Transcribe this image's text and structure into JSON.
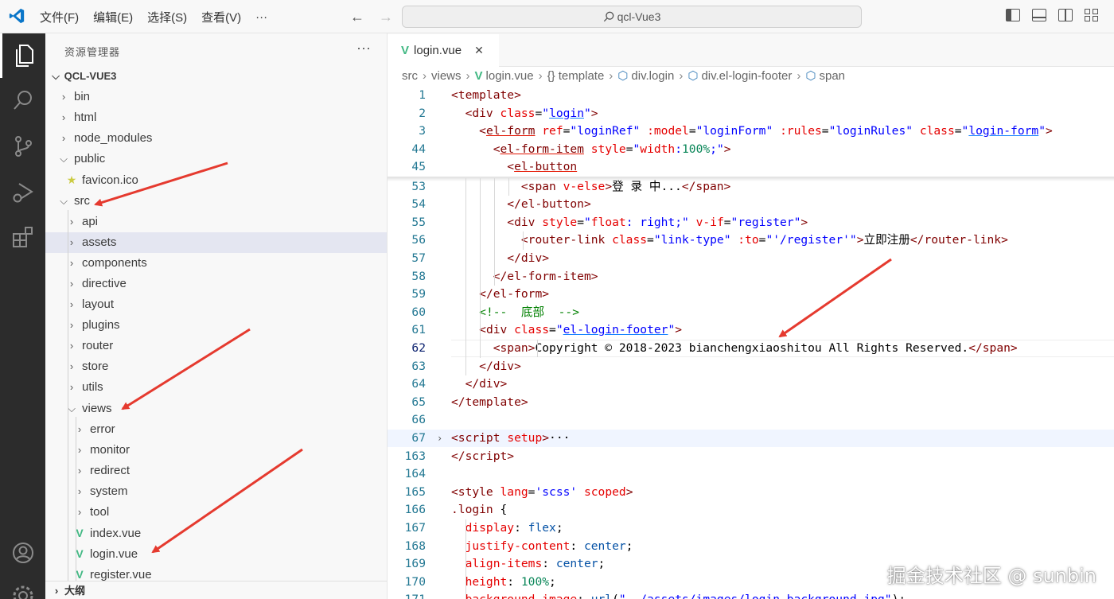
{
  "titlebar": {
    "menu": [
      "文件(F)",
      "编辑(E)",
      "选择(S)",
      "查看(V)",
      "···"
    ],
    "search": "qcl-Vue3"
  },
  "activity": [
    "files-icon",
    "search-icon",
    "source-control-icon",
    "run-debug-icon",
    "extensions-icon",
    "account-icon",
    "settings-icon"
  ],
  "sidebar": {
    "title": "资源管理器",
    "more": "···",
    "root": "QCL-VUE3",
    "items": [
      {
        "label": "bin",
        "depth": 1,
        "type": "folder",
        "open": false
      },
      {
        "label": "html",
        "depth": 1,
        "type": "folder",
        "open": false
      },
      {
        "label": "node_modules",
        "depth": 1,
        "type": "folder",
        "open": false
      },
      {
        "label": "public",
        "depth": 1,
        "type": "folder",
        "open": true
      },
      {
        "label": "favicon.ico",
        "depth": 2,
        "type": "star"
      },
      {
        "label": "src",
        "depth": 1,
        "type": "folder",
        "open": true
      },
      {
        "label": "api",
        "depth": 2,
        "type": "folder",
        "open": false
      },
      {
        "label": "assets",
        "depth": 2,
        "type": "folder",
        "open": false,
        "selected": true
      },
      {
        "label": "components",
        "depth": 2,
        "type": "folder",
        "open": false
      },
      {
        "label": "directive",
        "depth": 2,
        "type": "folder",
        "open": false
      },
      {
        "label": "layout",
        "depth": 2,
        "type": "folder",
        "open": false
      },
      {
        "label": "plugins",
        "depth": 2,
        "type": "folder",
        "open": false
      },
      {
        "label": "router",
        "depth": 2,
        "type": "folder",
        "open": false
      },
      {
        "label": "store",
        "depth": 2,
        "type": "folder",
        "open": false
      },
      {
        "label": "utils",
        "depth": 2,
        "type": "folder",
        "open": false
      },
      {
        "label": "views",
        "depth": 2,
        "type": "folder",
        "open": true
      },
      {
        "label": "error",
        "depth": 3,
        "type": "folder",
        "open": false
      },
      {
        "label": "monitor",
        "depth": 3,
        "type": "folder",
        "open": false
      },
      {
        "label": "redirect",
        "depth": 3,
        "type": "folder",
        "open": false
      },
      {
        "label": "system",
        "depth": 3,
        "type": "folder",
        "open": false
      },
      {
        "label": "tool",
        "depth": 3,
        "type": "folder",
        "open": false
      },
      {
        "label": "index.vue",
        "depth": 3,
        "type": "vue"
      },
      {
        "label": "login.vue",
        "depth": 3,
        "type": "vue"
      },
      {
        "label": "register.vue",
        "depth": 3,
        "type": "vue"
      }
    ],
    "outline": "大纲"
  },
  "editor": {
    "tab_label": "login.vue",
    "tab_close": "✕",
    "breadcrumb": [
      "src",
      "views",
      "login.vue",
      "{} template",
      "div.login",
      "div.el-login-footer",
      "span"
    ],
    "lines": [
      {
        "n": "1",
        "html": "<span class=\"tg\">&lt;template&gt;</span>"
      },
      {
        "n": "2",
        "html": "  <span class=\"tg\">&lt;div</span> <span class=\"at\">class</span>=<span class=\"vl\">\"<span class=\"ulb\">login</span>\"</span><span class=\"tg\">&gt;</span>"
      },
      {
        "n": "3",
        "html": "    <span class=\"tg\">&lt;<span class=\"ul\">el-form</span></span> <span class=\"at\">ref</span>=<span class=\"vl\">\"loginRef\"</span> <span class=\"at\">:model</span>=<span class=\"vl\">\"loginForm\"</span> <span class=\"at\">:rules</span>=<span class=\"vl\">\"loginRules\"</span> <span class=\"at\">class</span>=<span class=\"vl\">\"<span class=\"ulb\">login-form</span>\"</span><span class=\"tg\">&gt;</span>"
      },
      {
        "n": "44",
        "html": "      <span class=\"tg\">&lt;<span class=\"ul\">el-form-item</span></span> <span class=\"at\">style</span>=<span class=\"vl\">\"<span class=\"pr\">width</span>:<span class=\"nm\">100%</span>;\"</span><span class=\"tg\">&gt;</span>"
      },
      {
        "n": "45",
        "html": "        <span class=\"tg\">&lt;<span class=\"ul\">el-button</span></span>"
      },
      {
        "n": "53",
        "html": "          <span class=\"tg\">&lt;span</span> <span class=\"at\">v-else</span><span class=\"tg\">&gt;</span>登 录 中...<span class=\"tg\">&lt;/span&gt;</span>"
      },
      {
        "n": "54",
        "html": "        <span class=\"tg\">&lt;/el-button&gt;</span>"
      },
      {
        "n": "55",
        "html": "        <span class=\"tg\">&lt;div</span> <span class=\"at\">style</span>=<span class=\"vl\">\"<span class=\"pr\">float</span>: right;\"</span> <span class=\"at\">v-if</span>=<span class=\"vl\">\"register\"</span><span class=\"tg\">&gt;</span>"
      },
      {
        "n": "56",
        "html": "          <span class=\"tg\">&lt;router-link</span> <span class=\"at\">class</span>=<span class=\"vl\">\"link-type\"</span> <span class=\"at\">:to</span>=<span class=\"vl\">\"'/register'\"</span><span class=\"tg\">&gt;</span>立即注册<span class=\"tg\">&lt;/router-link&gt;</span>"
      },
      {
        "n": "57",
        "html": "        <span class=\"tg\">&lt;/div&gt;</span>"
      },
      {
        "n": "58",
        "html": "      <span class=\"tg\">&lt;/el-form-item&gt;</span>"
      },
      {
        "n": "59",
        "html": "    <span class=\"tg\">&lt;/el-form&gt;</span>"
      },
      {
        "n": "60",
        "html": "    <span class=\"cm\">&lt;!--  底部  --&gt;</span>"
      },
      {
        "n": "61",
        "html": "    <span class=\"tg\">&lt;div</span> <span class=\"at\">class</span>=<span class=\"vl\">\"<span class=\"ulb\">el-login-footer</span>\"</span><span class=\"tg\">&gt;</span>"
      },
      {
        "n": "62",
        "html": "      <span class=\"tg\">&lt;span&gt;</span>Copyright © 2018-2023 bianchengxiaoshitou All Rights Reserved.<span class=\"tg\">&lt;/span&gt;</span>",
        "current": true
      },
      {
        "n": "63",
        "html": "    <span class=\"tg\">&lt;/div&gt;</span>"
      },
      {
        "n": "64",
        "html": "  <span class=\"tg\">&lt;/div&gt;</span>"
      },
      {
        "n": "65",
        "html": "<span class=\"tg\">&lt;/template&gt;</span>"
      },
      {
        "n": "66",
        "html": ""
      },
      {
        "n": "67",
        "html": "<span class=\"tg\">&lt;script</span> <span class=\"at\">setup</span><span class=\"tg\">&gt;</span>···",
        "folded": true
      },
      {
        "n": "163",
        "html": "<span class=\"tg\">&lt;/script&gt;</span>"
      },
      {
        "n": "164",
        "html": ""
      },
      {
        "n": "165",
        "html": "<span class=\"tg\">&lt;style</span> <span class=\"at\">lang</span>=<span class=\"vl\">'scss'</span> <span class=\"at\">scoped</span><span class=\"tg\">&gt;</span>"
      },
      {
        "n": "166",
        "html": "<span class=\"dx\">.login</span> {"
      },
      {
        "n": "167",
        "html": "  <span class=\"pr\">display</span>: <span class=\"kw\">flex</span>;"
      },
      {
        "n": "168",
        "html": "  <span class=\"pr\">justify-content</span>: <span class=\"kw\">center</span>;"
      },
      {
        "n": "169",
        "html": "  <span class=\"pr\">align-items</span>: <span class=\"kw\">center</span>;"
      },
      {
        "n": "170",
        "html": "  <span class=\"pr\">height</span>: <span class=\"nm\">100%</span>;"
      },
      {
        "n": "171",
        "html": "  <span class=\"pr\">background-image</span>: <span class=\"kw\">url</span>(<span class=\"vl\">\"../assets/images/login-background.jpg\"</span>);"
      }
    ]
  },
  "watermark": "掘金技术社区 @ sunbin"
}
